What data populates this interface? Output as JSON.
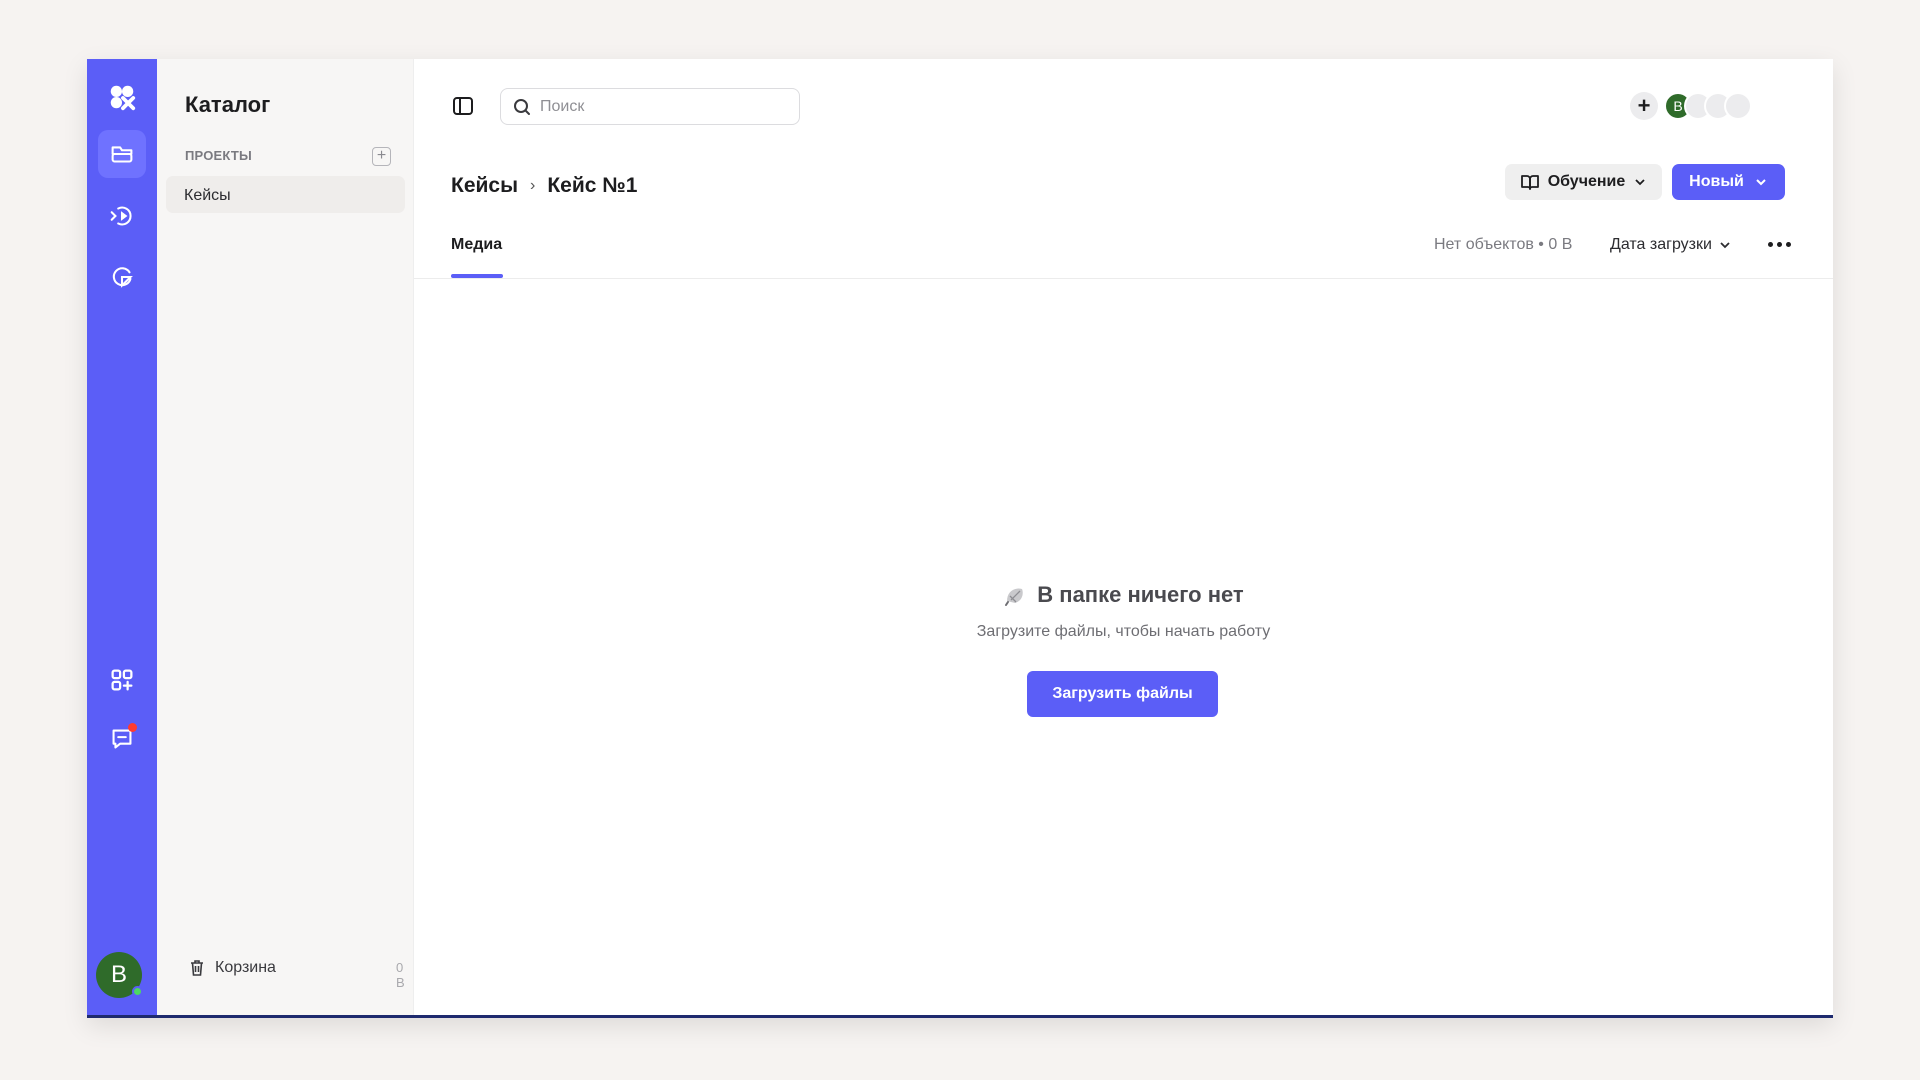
{
  "catalog": {
    "title": "Каталог",
    "projects_label": "ПРОЕКТЫ",
    "items": [
      {
        "label": "Кейсы"
      }
    ],
    "trash_label": "Корзина",
    "trash_size": "0 B"
  },
  "rail": {
    "avatar_initial": "B"
  },
  "search": {
    "placeholder": "Поиск"
  },
  "presence": {
    "user_initial": "B"
  },
  "breadcrumb": {
    "root": "Кейсы",
    "separator": "›",
    "current": "Кейс №1"
  },
  "toolbar": {
    "learn_label": "Обучение",
    "new_label": "Новый"
  },
  "tabs": [
    {
      "label": "Медиа"
    }
  ],
  "status": {
    "stats": "Нет объектов • 0 B",
    "sort_label": "Дата загрузки"
  },
  "empty": {
    "title": "В папке ничего нет",
    "subtitle": "Загрузите файлы, чтобы начать работу",
    "button_label": "Загрузить файлы"
  },
  "colors": {
    "accent": "#5b5ef7",
    "avatar": "#2f6b2a",
    "notification": "#ff3b30"
  }
}
